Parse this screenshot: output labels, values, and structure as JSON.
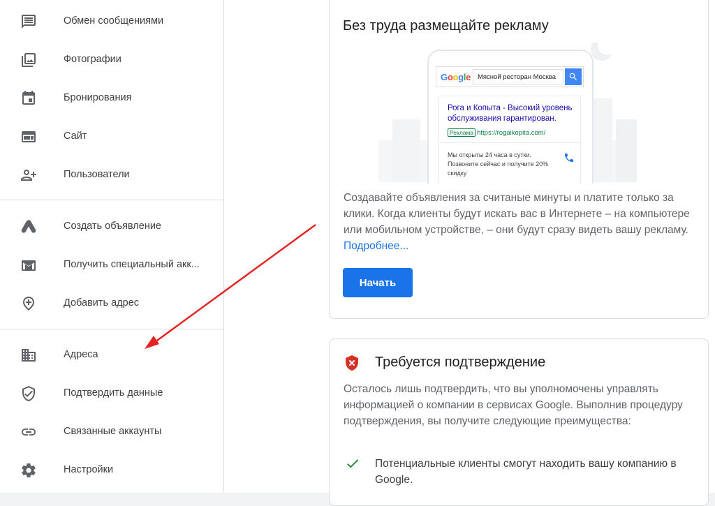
{
  "sidebar": {
    "items": [
      {
        "label": "Обмен сообщениями",
        "icon": "message-icon"
      },
      {
        "label": "Фотографии",
        "icon": "photo-icon"
      },
      {
        "label": "Бронирования",
        "icon": "calendar-icon"
      },
      {
        "label": "Сайт",
        "icon": "website-icon"
      },
      {
        "label": "Пользователи",
        "icon": "add-person-icon"
      },
      {
        "label": "Создать объявление",
        "icon": "google-ads-icon"
      },
      {
        "label": "Получить специальный акк...",
        "icon": "gmail-icon"
      },
      {
        "label": "Добавить адрес",
        "icon": "add-location-icon"
      },
      {
        "label": "Адреса",
        "icon": "building-icon"
      },
      {
        "label": "Подтвердить данные",
        "icon": "verified-shield-icon"
      },
      {
        "label": "Связанные аккаунты",
        "icon": "link-icon"
      },
      {
        "label": "Настройки",
        "icon": "settings-icon"
      }
    ]
  },
  "ads_card": {
    "title": "Без труда размещайте рекламу",
    "text": "Создавайте объявления за считаные минуты и платите только за клики. Когда клиенты будут искать вас в Интернете – на компьютере или мобильном устройстве, – они будут сразу видеть вашу рекламу.",
    "link": "Подробнее...",
    "button": "Начать",
    "illustration": {
      "logo": "Google",
      "query": "Мясной ресторан Москва",
      "ad_title": "Рога и Копыта - Высокий уровень обслуживания гарантирован.",
      "ad_badge": "Реклама",
      "ad_url": "https://rogaikopita.com/",
      "ad_desc": "Мы открыты 24 часа в сутки. Позвоните сейчас и получите 20% скидку"
    }
  },
  "verify_card": {
    "title": "Требуется подтверждение",
    "text": "Осталось лишь подтвердить, что вы уполномочены управлять информацией о компании в сервисах Google. Выполнив процедуру подтверждения, вы получите следующие преимущества:",
    "benefit": "Потенциальные клиенты смогут находить вашу компанию в Google."
  },
  "colors": {
    "accent": "#1a73e8",
    "arrow": "#e52421",
    "shield": "#d93025",
    "check": "#188038"
  }
}
